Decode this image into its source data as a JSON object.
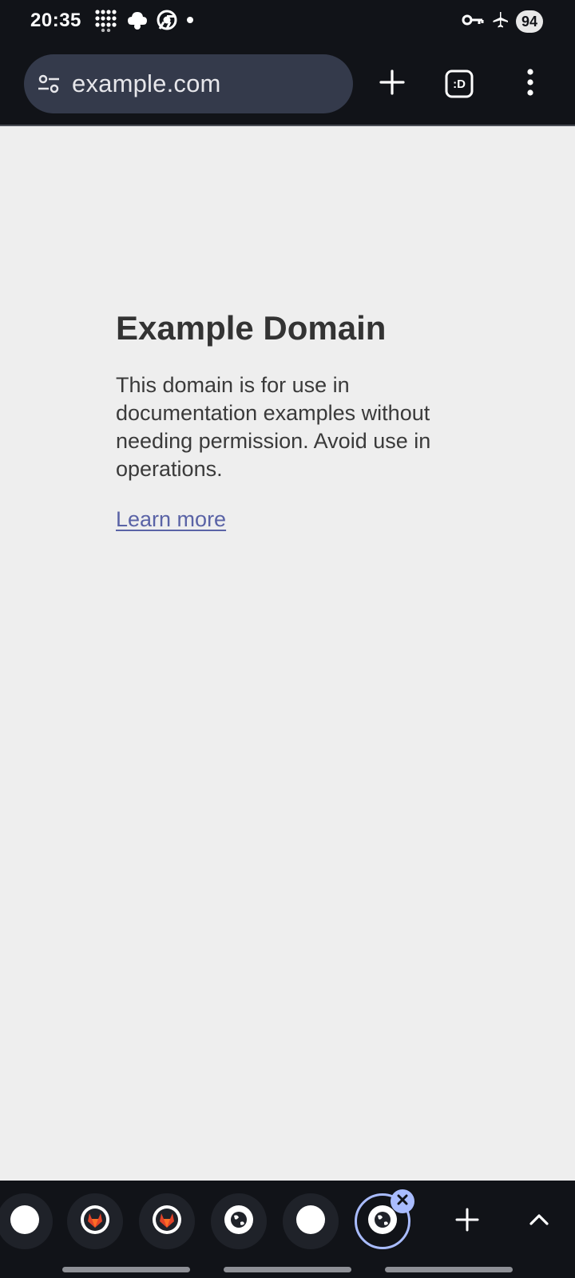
{
  "status_bar": {
    "time": "20:35",
    "left_icons": [
      "grid-dots-icon",
      "cloud-gear-icon",
      "chrome-icon",
      "notification-dot-icon"
    ],
    "right_icons": [
      "vpn-key-icon",
      "airplane-mode-icon"
    ],
    "battery_level": "94"
  },
  "toolbar": {
    "url": "example.com",
    "buttons": [
      "new-tab-icon",
      "tab-switcher-icon",
      "overflow-menu-icon"
    ],
    "tab_switcher_label": ":D"
  },
  "page": {
    "title": "Example Domain",
    "body": "This domain is for use in documentation examples without needing permission. Avoid use in operations.",
    "link": "Learn more",
    "link_color": "#5a63a6"
  },
  "tab_strip": {
    "tabs": [
      {
        "icon": "blank-favicon"
      },
      {
        "icon": "gitlab-favicon"
      },
      {
        "icon": "gitlab-favicon"
      },
      {
        "icon": "globe-favicon"
      },
      {
        "icon": "blank-favicon"
      },
      {
        "icon": "globe-favicon",
        "selected": true
      }
    ],
    "accent_color": "#a9bcff"
  }
}
